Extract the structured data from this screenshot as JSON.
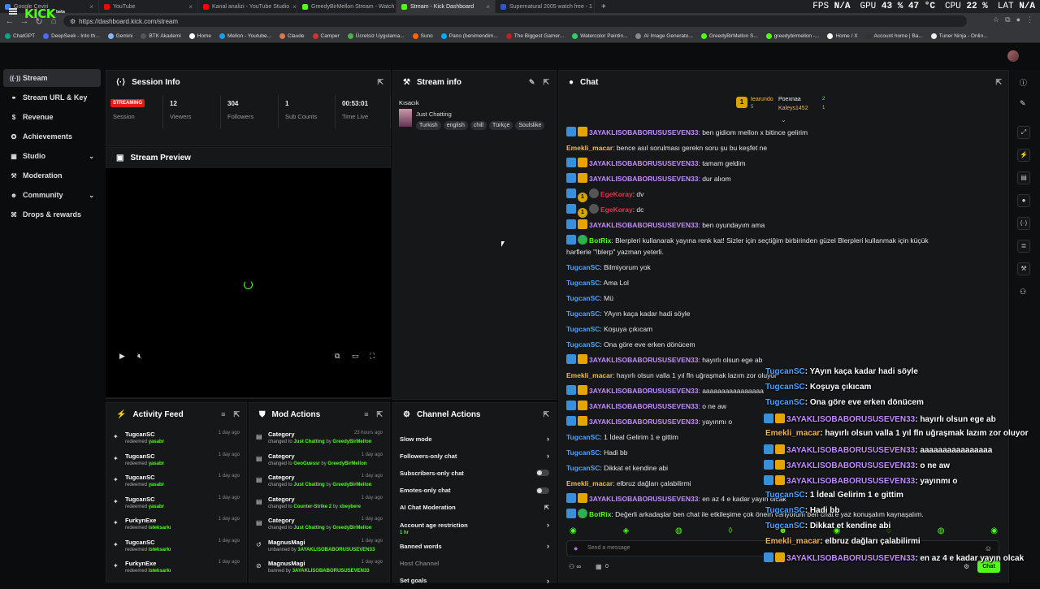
{
  "browser": {
    "tabs": [
      {
        "title": "Google Çeviri",
        "color": "#4285f4"
      },
      {
        "title": "YouTube",
        "color": "#ff0000"
      },
      {
        "title": "Kanal analizi - YouTube Studio",
        "color": "#ff0000"
      },
      {
        "title": "GreedyBirMellon Stream - Watch l",
        "color": "#53fc18"
      },
      {
        "title": "Stream - Kick Dashboard",
        "color": "#53fc18"
      },
      {
        "title": "Supernatural 2005 watch free - 1",
        "color": "#3355cc"
      }
    ],
    "new_tab": "+",
    "url": "https://dashboard.kick.com/stream",
    "perf": {
      "fps_label": "FPS",
      "fps": "N/A",
      "gpu_label": "GPU",
      "gpu": "43 %",
      "gpu_temp": "47 °C",
      "cpu_label": "CPU",
      "cpu": "22 %",
      "lat_label": "LAT",
      "lat": "N/A"
    },
    "bookmarks": [
      "ChatGPT",
      "DeepSeek - Into th...",
      "Gemini",
      "BTK Akademi",
      "Home",
      "Mellon - Youtube...",
      "Claude",
      "Camper",
      "Ücretsiz Uygulama...",
      "Suno",
      "Pano (benimendim...",
      "The Biggest Gamer...",
      "Watercolor Paintin...",
      "AI Image Generato...",
      "GreedyBirMellon S...",
      "greedybirmellon -...",
      "Home / X",
      "Account home | Ba...",
      "Tuner Ninja - Onlin..."
    ]
  },
  "app": {
    "logo": "KICK",
    "logo_sup": "beta"
  },
  "sidebar": {
    "items": [
      {
        "label": "Stream",
        "icon": "((·))"
      },
      {
        "label": "Stream URL & Key",
        "icon": "⚭"
      },
      {
        "label": "Revenue",
        "icon": "$"
      },
      {
        "label": "Achievements",
        "icon": "✪"
      },
      {
        "label": "Studio",
        "icon": "▦",
        "chev": "⌄"
      },
      {
        "label": "Moderation",
        "icon": "⚒"
      },
      {
        "label": "Community",
        "icon": "☻",
        "chev": "⌄"
      },
      {
        "label": "Drops & rewards",
        "icon": "⌘"
      }
    ]
  },
  "session": {
    "title": "Session Info",
    "badge": "STREAMING",
    "stats": [
      {
        "value": "",
        "label": "Session"
      },
      {
        "value": "12",
        "label": "Viewers"
      },
      {
        "value": "304",
        "label": "Followers"
      },
      {
        "value": "1",
        "label": "Sub Counts"
      },
      {
        "value": "00:53:01",
        "label": "Time Live"
      }
    ]
  },
  "preview": {
    "title": "Stream Preview"
  },
  "stream_info": {
    "title": "Stream info",
    "stream_title": "Kısacık",
    "category": "Just Chatting",
    "tags": [
      "Turkish",
      "english",
      "chill",
      "Türkçe",
      "Soulslike"
    ]
  },
  "activity": {
    "title": "Activity Feed",
    "items": [
      {
        "name": "TugcanSC",
        "action": "redeemed",
        "reward": "yasabr",
        "time": "1 day ago"
      },
      {
        "name": "TugcanSC",
        "action": "redeemed",
        "reward": "yasabr",
        "time": "1 day ago"
      },
      {
        "name": "TugcanSC",
        "action": "redeemed",
        "reward": "yasabr",
        "time": "1 day ago"
      },
      {
        "name": "TugcanSC",
        "action": "redeemed",
        "reward": "yasabr",
        "time": "1 day ago"
      },
      {
        "name": "FurkynExe",
        "action": "redeemed",
        "reward": "isteksarkı",
        "time": "1 day ago"
      },
      {
        "name": "TugcanSC",
        "action": "redeemed",
        "reward": "isteksarkı",
        "time": "1 day ago"
      },
      {
        "name": "FurkynExe",
        "action": "redeemed",
        "reward": "isteksarkı",
        "time": "1 day ago"
      }
    ]
  },
  "mod": {
    "title": "Mod Actions",
    "items": [
      {
        "name": "Category",
        "pre": "changed to",
        "target": "Just Chatting",
        "mid": "by",
        "by": "GreedyBirMellon",
        "time": "23 hours ago"
      },
      {
        "name": "Category",
        "pre": "changed to",
        "target": "GeoGuessr",
        "mid": "by",
        "by": "GreedyBirMellon",
        "time": "1 day ago"
      },
      {
        "name": "Category",
        "pre": "changed to",
        "target": "Just Chatting",
        "mid": "by",
        "by": "GreedyBirMellon",
        "time": "1 day ago"
      },
      {
        "name": "Category",
        "pre": "changed to",
        "target": "Counter-Strike 2",
        "mid": "by",
        "by": "xbeybere",
        "time": "1 day ago"
      },
      {
        "name": "Category",
        "pre": "changed to",
        "target": "Just Chatting",
        "mid": "by",
        "by": "GreedyBirMellon",
        "time": "1 day ago"
      },
      {
        "name": "MagnusMagi",
        "pre": "unbanned by",
        "target": "3AYAKLISOBABORUSUSEVEN33",
        "mid": "",
        "by": "",
        "time": "1 day ago"
      },
      {
        "name": "MagnusMagi",
        "pre": "banned by",
        "target": "3AYAKLISOBABORUSUSEVEN33",
        "mid": "",
        "by": "",
        "time": "1 day ago"
      }
    ]
  },
  "channel": {
    "title": "Channel Actions",
    "items": [
      {
        "label": "Slow mode",
        "kind": "arrow"
      },
      {
        "label": "Followers-only chat",
        "kind": "arrow"
      },
      {
        "label": "Subscribers-only chat",
        "kind": "toggle"
      },
      {
        "label": "Emotes-only chat",
        "kind": "toggle"
      },
      {
        "label": "AI Chat Moderation",
        "kind": "ext"
      },
      {
        "label": "Account age restriction",
        "kind": "arrow",
        "sub": "1 hr"
      },
      {
        "label": "Banned words",
        "kind": "arrow"
      },
      {
        "label": "Host Channel",
        "kind": "none"
      },
      {
        "label": "Set goals",
        "kind": "arrow"
      }
    ]
  },
  "chat": {
    "title": "Chat",
    "top_users": [
      {
        "name": "tearundo",
        "n": "5"
      },
      {
        "name": "Poexnaa",
        "n": "2"
      },
      {
        "name": "Kaleys1452",
        "n": "1"
      }
    ],
    "messages": [
      {
        "user": "3AYAKLISOBABORUSUSEVEN33",
        "color": "#c38cff",
        "badges": [
          "b1",
          "b2"
        ],
        "text": "ben gidiom mellon x bitince gelirim"
      },
      {
        "user": "Emekli_macar",
        "color": "#f2b84b",
        "badges": [],
        "text": "bence asıl sorulması gerekn soru şu bu keşfet ne"
      },
      {
        "user": "3AYAKLISOBABORUSUSEVEN33",
        "color": "#c38cff",
        "badges": [
          "b1",
          "b2"
        ],
        "text": "tamam geldim"
      },
      {
        "user": "3AYAKLISOBABORUSUSEVEN33",
        "color": "#c38cff",
        "badges": [
          "b1",
          "b2"
        ],
        "text": "dur alıom"
      },
      {
        "user": "EgeKoray",
        "color": "#e8324a",
        "badges": [
          "b1",
          "b4",
          "b5"
        ],
        "text": "dv"
      },
      {
        "user": "EgeKoray",
        "color": "#e8324a",
        "badges": [
          "b1",
          "b4",
          "b5"
        ],
        "text": "dc"
      },
      {
        "user": "3AYAKLISOBABORUSUSEVEN33",
        "color": "#c38cff",
        "badges": [
          "b1",
          "b2"
        ],
        "text": "ben oyundayım ama"
      },
      {
        "user": "BotRix",
        "color": "#53fc18",
        "badges": [
          "b1",
          "b3"
        ],
        "text": "Blerpleri kullanarak yayına renk kat! Sizler için seçtiğim birbirinden güzel Blerpleri kullanmak için küçük",
        "text2": "harflerle \"!blerp\" yazman yeterli."
      },
      {
        "user": "TugcanSC",
        "color": "#4aa3ff",
        "badges": [],
        "text": "Bilmiyorum yok"
      },
      {
        "user": "TugcanSC",
        "color": "#4aa3ff",
        "badges": [],
        "text": "Ama Lol"
      },
      {
        "user": "TugcanSC",
        "color": "#4aa3ff",
        "badges": [],
        "text": "Mü"
      },
      {
        "user": "TugcanSC",
        "color": "#4aa3ff",
        "badges": [],
        "text": "YAyın kaça kadar hadi söyle"
      },
      {
        "user": "TugcanSC",
        "color": "#4aa3ff",
        "badges": [],
        "text": "Koşuya çıkıcam"
      },
      {
        "user": "TugcanSC",
        "color": "#4aa3ff",
        "badges": [],
        "text": "Ona göre eve erken dönücem"
      },
      {
        "user": "3AYAKLISOBABORUSUSEVEN33",
        "color": "#c38cff",
        "badges": [
          "b1",
          "b2"
        ],
        "text": "hayırlı olsun ege ab"
      },
      {
        "user": "Emekli_macar",
        "color": "#f2b84b",
        "badges": [],
        "text": "hayırlı olsun valla 1 yıl fln uğraşmak lazım zor oluyor"
      },
      {
        "user": "3AYAKLISOBABORUSUSEVEN33",
        "color": "#c38cff",
        "badges": [
          "b1",
          "b2"
        ],
        "text": "aaaaaaaaaaaaaaaa"
      },
      {
        "user": "3AYAKLISOBABORUSUSEVEN33",
        "color": "#c38cff",
        "badges": [
          "b1",
          "b2"
        ],
        "text": "o ne aw"
      },
      {
        "user": "3AYAKLISOBABORUSUSEVEN33",
        "color": "#c38cff",
        "badges": [
          "b1",
          "b2"
        ],
        "text": "yayınmı o"
      },
      {
        "user": "TugcanSC",
        "color": "#4aa3ff",
        "badges": [],
        "text": "1 İdeal Gelirim 1 e gittim"
      },
      {
        "user": "TugcanSC",
        "color": "#4aa3ff",
        "badges": [],
        "text": "Hadi bb"
      },
      {
        "user": "TugcanSC",
        "color": "#4aa3ff",
        "badges": [],
        "text": "Dikkat et kendine abi"
      },
      {
        "user": "Emekli_macar",
        "color": "#f2b84b",
        "badges": [],
        "text": "elbruz dağları çalabilirmi"
      },
      {
        "user": "3AYAKLISOBABORUSUSEVEN33",
        "color": "#c38cff",
        "badges": [
          "b1",
          "b2"
        ],
        "text": "en az 4 e kadar yayın olcak"
      },
      {
        "user": "BotRix",
        "color": "#53fc18",
        "badges": [
          "b1",
          "b3"
        ],
        "text": "Değerli arkadaşlar ben chat ile etkileşime çok önem veriyorum ben chat'e yaz konuşalım kaynaşalım."
      }
    ],
    "input_placeholder": "Send a message",
    "send_label": "Chat",
    "footer_count": "0"
  },
  "overlay": {
    "messages": [
      {
        "user": "TugcanSC",
        "color": "#4aa3ff",
        "badges": [],
        "text": "YAyın kaça kadar hadi söyle"
      },
      {
        "user": "TugcanSC",
        "color": "#4aa3ff",
        "badges": [],
        "text": "Koşuya çıkıcam"
      },
      {
        "user": "TugcanSC",
        "color": "#4aa3ff",
        "badges": [],
        "text": "Ona göre eve erken dönücem"
      },
      {
        "user": "3AYAKLISOBABORUSUSEVEN33",
        "color": "#c38cff",
        "badges": [
          "b1",
          "b2"
        ],
        "text": "hayırlı olsun ege ab"
      },
      {
        "user": "Emekli_macar",
        "color": "#f2b84b",
        "badges": [],
        "text": "hayırlı olsun valla 1 yıl fln uğraşmak lazım zor oluyor"
      },
      {
        "user": "3AYAKLISOBABORUSUSEVEN33",
        "color": "#c38cff",
        "badges": [
          "b1",
          "b2"
        ],
        "text": "aaaaaaaaaaaaaaaa"
      },
      {
        "user": "3AYAKLISOBABORUSUSEVEN33",
        "color": "#c38cff",
        "badges": [
          "b1",
          "b2"
        ],
        "text": "o ne aw"
      },
      {
        "user": "3AYAKLISOBABORUSUSEVEN33",
        "color": "#c38cff",
        "badges": [
          "b1",
          "b2"
        ],
        "text": "yayınmı o"
      },
      {
        "user": "TugcanSC",
        "color": "#4aa3ff",
        "badges": [],
        "text": "1 İdeal Gelirim 1 e gittim"
      },
      {
        "user": "TugcanSC",
        "color": "#4aa3ff",
        "badges": [],
        "text": "Hadi bb"
      },
      {
        "user": "TugcanSC",
        "color": "#4aa3ff",
        "badges": [],
        "text": "Dikkat et kendine abi"
      },
      {
        "user": "Emekli_macar",
        "color": "#f2b84b",
        "badges": [],
        "text": "elbruz dağları çalabilirmi"
      },
      {
        "user": "3AYAKLISOBABORUSUSEVEN33",
        "color": "#c38cff",
        "badges": [
          "b1",
          "b2"
        ],
        "text": "en az 4 e kadar yayın olcak"
      }
    ]
  }
}
